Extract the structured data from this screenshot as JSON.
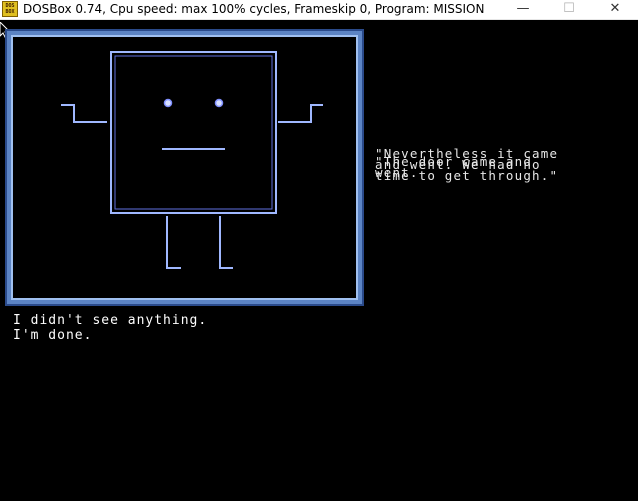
{
  "window": {
    "title": "DOSBox 0.74, Cpu speed: max 100% cycles, Frameskip  0, Program:  MISSION",
    "app_icon_text": "DOS BOX",
    "minimize_glyph": "—",
    "maximize_glyph": "☐",
    "close_glyph": "✕"
  },
  "scene": {
    "quote_line_1": "\"Nevertheless it came\nand went. We had no\ntime to get through.\"",
    "quote_line_2": "\"The door came and\nwent."
  },
  "terminal": {
    "line_1": "I didn't see anything.",
    "line_2": "I'm done."
  },
  "colors": {
    "frame_blue": "#5c84c4",
    "figure_blue": "#a0b8ff"
  }
}
